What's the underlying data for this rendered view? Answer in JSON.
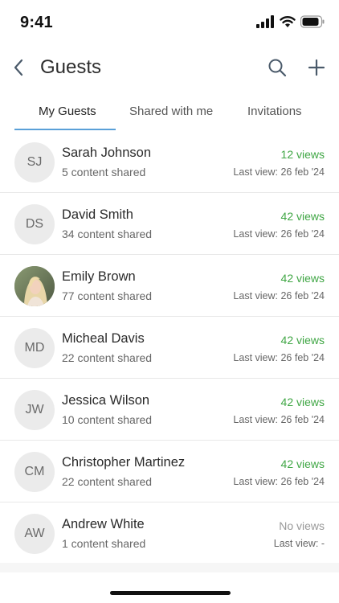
{
  "status_bar": {
    "time": "9:41",
    "icons": [
      "signal-icon",
      "wifi-icon",
      "battery-icon"
    ]
  },
  "nav": {
    "title": "Guests",
    "icons": {
      "back": "chevron-left-icon",
      "search": "search-icon",
      "add": "plus-icon"
    }
  },
  "tabs": [
    {
      "label": "My Guests",
      "active": true
    },
    {
      "label": "Shared with me",
      "active": false
    },
    {
      "label": "Invitations",
      "active": false
    }
  ],
  "colors": {
    "accent_tab": "#5aa0d8",
    "views_green": "#3fa644",
    "views_gray": "#999999",
    "avatar_bg": "#ebebeb"
  },
  "guests": [
    {
      "initials": "SJ",
      "name": "Sarah Johnson",
      "shared": "5 content shared",
      "views": "12 views",
      "last_view": "Last view: 26 feb '24"
    },
    {
      "initials": "DS",
      "name": "David Smith",
      "shared": "34 content shared",
      "views": "42 views",
      "last_view": "Last view: 26 feb '24"
    },
    {
      "initials": "",
      "photo": true,
      "name": "Emily Brown",
      "shared": "77 content shared",
      "views": "42 views",
      "last_view": "Last view: 26 feb '24"
    },
    {
      "initials": "MD",
      "name": "Micheal Davis",
      "shared": "22 content shared",
      "views": "42 views",
      "last_view": "Last view: 26 feb '24"
    },
    {
      "initials": "JW",
      "name": "Jessica Wilson",
      "shared": "10 content shared",
      "views": "42 views",
      "last_view": "Last view: 26 feb '24"
    },
    {
      "initials": "CM",
      "name": "Christopher Martinez",
      "shared": "22 content shared",
      "views": "42 views",
      "last_view": "Last view: 26 feb '24"
    },
    {
      "initials": "AW",
      "name": "Andrew White",
      "shared": "1 content shared",
      "views": "No views",
      "last_view": "Last view: -"
    }
  ]
}
